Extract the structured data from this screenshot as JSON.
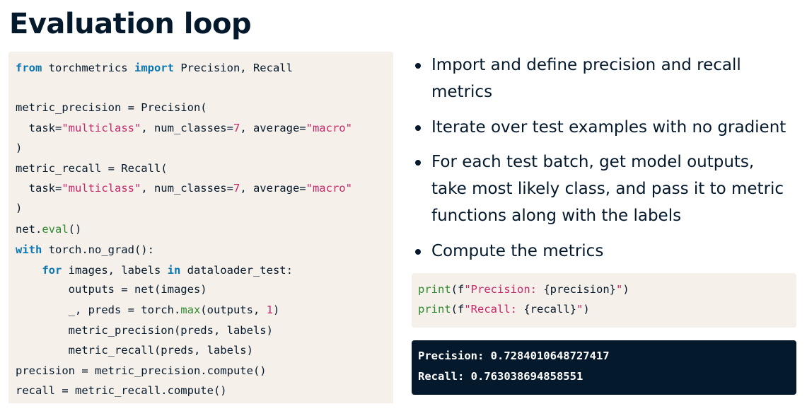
{
  "slide": {
    "title": "Evaluation loop"
  },
  "code": {
    "l1": {
      "kw1": "from",
      "mod": " torchmetrics ",
      "kw2": "import",
      "rest": " Precision, Recall"
    },
    "l3": {
      "text": "metric_precision = Precision("
    },
    "l4": {
      "a": "  task=",
      "s1": "\"multiclass\"",
      "b": ", num_classes=",
      "n": "7",
      "c": ", average=",
      "s2": "\"macro\""
    },
    "l5": {
      "text": ")"
    },
    "l6": {
      "text": "metric_recall = Recall("
    },
    "l7": {
      "a": "  task=",
      "s1": "\"multiclass\"",
      "b": ", num_classes=",
      "n": "7",
      "c": ", average=",
      "s2": "\"macro\""
    },
    "l8": {
      "text": ")"
    },
    "l9": {
      "a": "net.",
      "fn": "eval",
      "b": "()"
    },
    "l10": {
      "kw": "with",
      "rest": " torch.no_grad():"
    },
    "l11": {
      "indent": "    ",
      "kw1": "for",
      "a": " images, labels ",
      "kw2": "in",
      "b": " dataloader_test:"
    },
    "l12": {
      "text": "        outputs = net(images)"
    },
    "l13": {
      "a": "        _, preds = torch.",
      "fn": "max",
      "b": "(outputs, ",
      "n": "1",
      "c": ")"
    },
    "l14": {
      "text": "        metric_precision(preds, labels)"
    },
    "l15": {
      "text": "        metric_recall(preds, labels)"
    },
    "l16": {
      "text": "precision = metric_precision.compute()"
    },
    "l17": {
      "text": "recall = metric_recall.compute()"
    }
  },
  "bullets": [
    {
      "line1": "Import and define precision and recall",
      "line2": "metrics"
    },
    {
      "line1": "Iterate over test examples with no gradient"
    },
    {
      "line1": "For each test batch, get model outputs,",
      "line2": "take most likely class, and pass it to metric",
      "line3": "functions along with the labels"
    },
    {
      "line1": "Compute the metrics"
    }
  ],
  "print_code": {
    "p1": {
      "fn": "print",
      "a": "(f",
      "s1": "\"Precision: ",
      "expr": "{precision}",
      "s2": "\"",
      "b": ")"
    },
    "p2": {
      "fn": "print",
      "a": "(f",
      "s1": "\"Recall: ",
      "expr": "{recall}",
      "s2": "\"",
      "b": ")"
    }
  },
  "output": {
    "line1": "Precision: 0.7284010648727417",
    "line2": "Recall: 0.763038694858551"
  },
  "colors": {
    "keyword": "#0a78b4",
    "string": "#c4286b",
    "function": "#2e8b2e",
    "text": "#05192d",
    "code_bg": "#f5f1ea",
    "output_bg": "#05192d"
  }
}
